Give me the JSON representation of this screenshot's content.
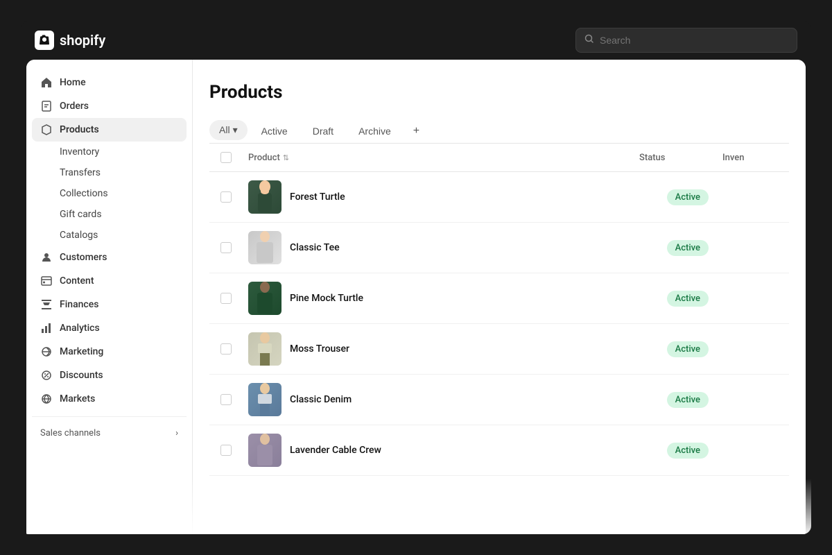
{
  "topbar": {
    "logo_text": "shopify",
    "search_placeholder": "Search"
  },
  "sidebar": {
    "nav_items": [
      {
        "id": "home",
        "label": "Home",
        "icon": "home"
      },
      {
        "id": "orders",
        "label": "Orders",
        "icon": "orders"
      },
      {
        "id": "products",
        "label": "Products",
        "icon": "products",
        "active": true
      },
      {
        "id": "customers",
        "label": "Customers",
        "icon": "customers"
      },
      {
        "id": "content",
        "label": "Content",
        "icon": "content"
      },
      {
        "id": "finances",
        "label": "Finances",
        "icon": "finances"
      },
      {
        "id": "analytics",
        "label": "Analytics",
        "icon": "analytics"
      },
      {
        "id": "marketing",
        "label": "Marketing",
        "icon": "marketing"
      },
      {
        "id": "discounts",
        "label": "Discounts",
        "icon": "discounts"
      },
      {
        "id": "markets",
        "label": "Markets",
        "icon": "markets"
      }
    ],
    "sub_items": [
      {
        "id": "inventory",
        "label": "Inventory"
      },
      {
        "id": "transfers",
        "label": "Transfers"
      },
      {
        "id": "collections",
        "label": "Collections"
      },
      {
        "id": "gift-cards",
        "label": "Gift cards"
      },
      {
        "id": "catalogs",
        "label": "Catalogs"
      }
    ],
    "sales_channels_label": "Sales channels"
  },
  "page": {
    "title": "Products"
  },
  "filter_tabs": [
    {
      "id": "all",
      "label": "All",
      "has_dropdown": true,
      "active": true
    },
    {
      "id": "active",
      "label": "Active"
    },
    {
      "id": "draft",
      "label": "Draft"
    },
    {
      "id": "archive",
      "label": "Archive"
    },
    {
      "id": "plus",
      "label": "+"
    }
  ],
  "table": {
    "headers": [
      {
        "id": "product",
        "label": "Product",
        "sortable": true
      },
      {
        "id": "status",
        "label": "Status"
      },
      {
        "id": "inventory",
        "label": "Inven"
      }
    ],
    "rows": [
      {
        "id": 1,
        "name": "Forest Turtle",
        "status": "Active",
        "thumb_class": "thumb-forest"
      },
      {
        "id": 2,
        "name": "Classic Tee",
        "status": "Active",
        "thumb_class": "thumb-classic-tee"
      },
      {
        "id": 3,
        "name": "Pine Mock Turtle",
        "status": "Active",
        "thumb_class": "thumb-pine"
      },
      {
        "id": 4,
        "name": "Moss Trouser",
        "status": "Active",
        "thumb_class": "thumb-moss"
      },
      {
        "id": 5,
        "name": "Classic Denim",
        "status": "Active",
        "thumb_class": "thumb-denim"
      },
      {
        "id": 6,
        "name": "Lavender Cable Crew",
        "status": "Active",
        "thumb_class": "thumb-lavender"
      }
    ]
  }
}
